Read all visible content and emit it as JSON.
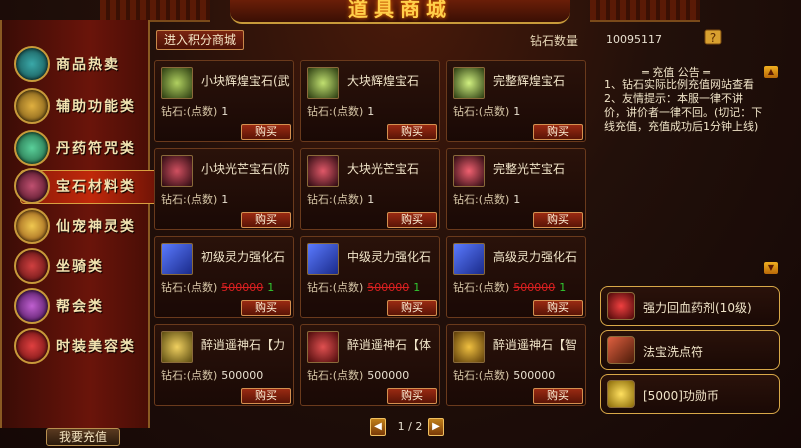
{
  "header": {
    "title": "道具商城",
    "points_mall_button": "进入积分商城",
    "diamond_label": "钻石数量",
    "diamond_value": "10095117"
  },
  "sidebar": {
    "items": [
      {
        "label": "商品热卖",
        "icon": "treasure-chest-icon",
        "color": "#2a8a8a"
      },
      {
        "label": "辅助功能类",
        "icon": "scroll-book-icon",
        "color": "#c89020"
      },
      {
        "label": "丹药符咒类",
        "icon": "elixir-orb-icon",
        "color": "#3a9a6a"
      },
      {
        "label": "宝石材料类",
        "icon": "gem-icon",
        "color": "#8a2a4a",
        "active": true
      },
      {
        "label": "仙宠神灵类",
        "icon": "spirit-pet-icon",
        "color": "#d0a030"
      },
      {
        "label": "坐骑类",
        "icon": "mount-icon",
        "color": "#b02020"
      },
      {
        "label": "帮会类",
        "icon": "guild-icon",
        "color": "#9a3aaa"
      },
      {
        "label": "时装美容类",
        "icon": "fashion-icon",
        "color": "#c02a2a"
      }
    ],
    "recharge_button": "我要充值"
  },
  "items": [
    {
      "name": "小块辉煌宝石(武",
      "price_label": "钻石:(点数)",
      "price": "1",
      "icon_color": "#8ab040",
      "icon": "brilliant-gem-small-icon",
      "buy": "购买"
    },
    {
      "name": "大块辉煌宝石",
      "price_label": "钻石:(点数)",
      "price": "1",
      "icon_color": "#9ac050",
      "icon": "brilliant-gem-large-icon",
      "buy": "购买"
    },
    {
      "name": "完整辉煌宝石",
      "price_label": "钻石:(点数)",
      "price": "1",
      "icon_color": "#a0d060",
      "icon": "brilliant-gem-full-icon",
      "buy": "购买"
    },
    {
      "name": "小块光芒宝石(防",
      "price_label": "钻石:(点数)",
      "price": "1",
      "icon_color": "#a03040",
      "icon": "radiant-gem-small-icon",
      "buy": "购买"
    },
    {
      "name": "大块光芒宝石",
      "price_label": "钻石:(点数)",
      "price": "1",
      "icon_color": "#c03848",
      "icon": "radiant-gem-large-icon",
      "buy": "购买"
    },
    {
      "name": "完整光芒宝石",
      "price_label": "钻石:(点数)",
      "price": "1",
      "icon_color": "#d04050",
      "icon": "radiant-gem-full-icon",
      "buy": "购买"
    },
    {
      "name": "初级灵力强化石",
      "price_label": "钻石:(点数)",
      "old_price": "500000",
      "price": "1",
      "icon_color": "#2a4ad0",
      "icon": "shield-stone-icon",
      "buy": "购买"
    },
    {
      "name": "中级灵力强化石",
      "price_label": "钻石:(点数)",
      "old_price": "500000",
      "price": "1",
      "icon_color": "#2a4ad0",
      "icon": "shield-stone-icon",
      "buy": "购买"
    },
    {
      "name": "高级灵力强化石",
      "price_label": "钻石:(点数)",
      "old_price": "500000",
      "price": "1",
      "icon_color": "#2a4ad0",
      "icon": "shield-stone-icon",
      "buy": "购买"
    },
    {
      "name": "醉逍遥神石【力",
      "price_label": "钻石:(点数)",
      "price": "500000",
      "icon_color": "#d8b040",
      "icon": "divine-stone-icon",
      "buy": "购买"
    },
    {
      "name": "醉逍遥神石【体",
      "price_label": "钻石:(点数)",
      "price": "500000",
      "icon_color": "#c03030",
      "icon": "divine-stone-icon",
      "buy": "购买"
    },
    {
      "name": "醉逍遥神石【智",
      "price_label": "钻石:(点数)",
      "price": "500000",
      "icon_color": "#d8a020",
      "icon": "divine-stone-icon",
      "buy": "购买"
    }
  ],
  "pager": {
    "text": "1 / 2",
    "prev": "◀",
    "next": "▶"
  },
  "notice": {
    "title": "═ 充值 公告 ═",
    "lines": [
      "1、钻石实际比例充值网站查看",
      "2、友情提示：本服一律不讲价，讲价者一律不回。(切记：下线充值，充值成功后1分钟上线)"
    ]
  },
  "quick_items": [
    {
      "label": "强力回血药剂(10级)",
      "icon": "potion-icon",
      "icon_color": "#d02020"
    },
    {
      "label": "法宝洗点符",
      "icon": "talisman-icon",
      "icon_color": "#c0402a"
    },
    {
      "label": "[5000]功勋币",
      "icon": "coin-icon",
      "icon_color": "#e8c020"
    }
  ]
}
